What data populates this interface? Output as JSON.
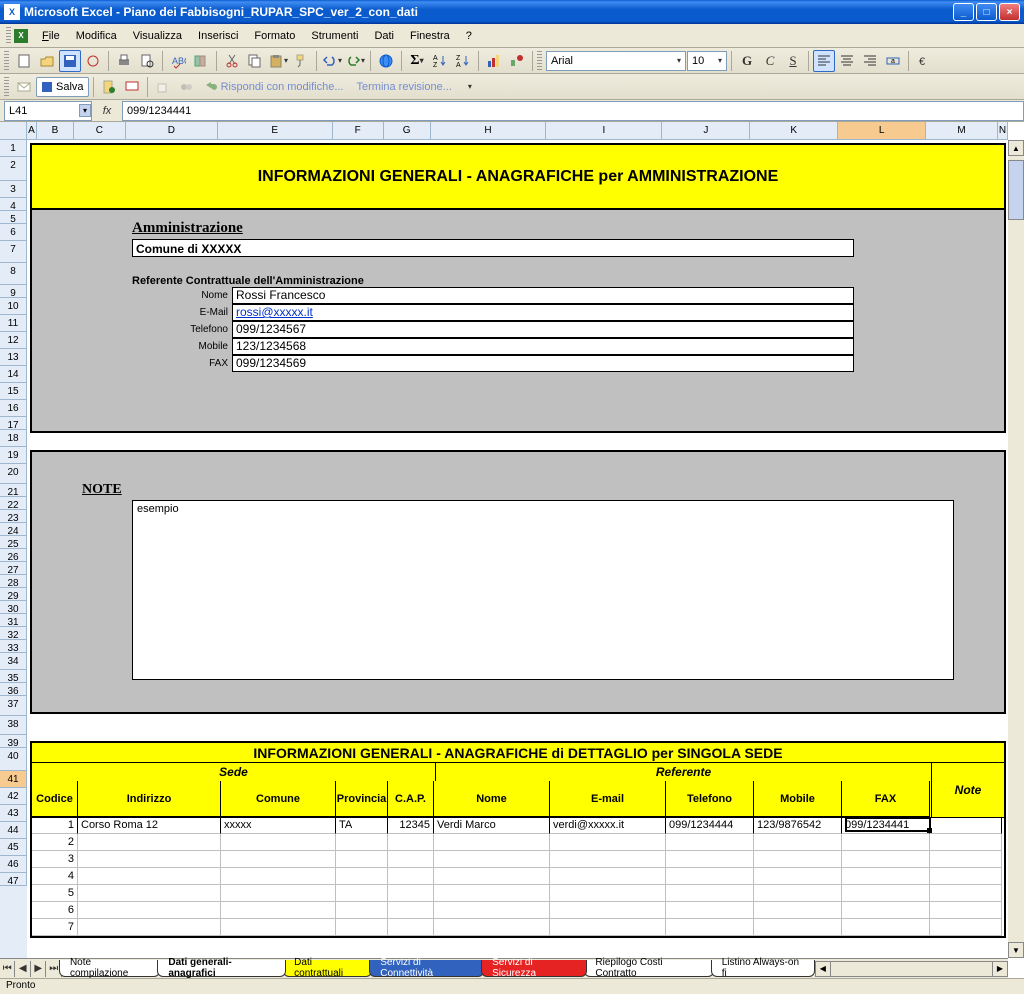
{
  "window": {
    "app": "Microsoft Excel",
    "document": "Piano dei Fabbisogni_RUPAR_SPC_ver_2_con_dati"
  },
  "menus": {
    "file": "File",
    "modifica": "Modifica",
    "visualizza": "Visualizza",
    "inserisci": "Inserisci",
    "formato": "Formato",
    "strumenti": "Strumenti",
    "dati": "Dati",
    "finestra": "Finestra",
    "help": "?"
  },
  "toolbar2": {
    "salva": "Salva",
    "rispondi": "Rispondi con modifiche...",
    "termina": "Termina revisione..."
  },
  "font": {
    "name": "Arial",
    "size": "10"
  },
  "namebox": "L41",
  "formula": "099/1234441",
  "columns": [
    "A",
    "B",
    "C",
    "D",
    "E",
    "F",
    "G",
    "H",
    "I",
    "J",
    "K",
    "L",
    "M",
    "N"
  ],
  "rows": [
    "1",
    "2",
    "3",
    "4",
    "5",
    "6",
    "7",
    "8",
    "9",
    "10",
    "11",
    "12",
    "13",
    "14",
    "15",
    "16",
    "17",
    "18",
    "19",
    "20",
    "21",
    "22",
    "23",
    "24",
    "25",
    "26",
    "27",
    "28",
    "29",
    "30",
    "31",
    "32",
    "33",
    "34",
    "35",
    "36",
    "37",
    "38",
    "39",
    "40",
    "41",
    "42",
    "43",
    "44",
    "45",
    "46",
    "47"
  ],
  "section1": {
    "title": "INFORMAZIONI GENERALI - ANAGRAFICHE per AMMINISTRAZIONE",
    "admin_label": "Amministrazione",
    "admin_value": "Comune di XXXXX",
    "ref_label": "Referente Contrattuale dell'Amministrazione",
    "fields": {
      "nome_l": "Nome",
      "nome_v": "Rossi Francesco",
      "email_l": "E-Mail",
      "email_v": "rossi@xxxxx.it",
      "tel_l": "Telefono",
      "tel_v": "099/1234567",
      "mob_l": "Mobile",
      "mob_v": "123/1234568",
      "fax_l": "FAX",
      "fax_v": "099/1234569"
    }
  },
  "section2": {
    "label": "NOTE",
    "value": "esempio"
  },
  "section3": {
    "title": "INFORMAZIONI GENERALI - ANAGRAFICHE di DETTAGLIO per SINGOLA SEDE",
    "groups": {
      "sede": "Sede",
      "referente": "Referente",
      "note": "Note"
    },
    "headers": {
      "codice": "Codice",
      "indirizzo": "Indirizzo",
      "comune": "Comune",
      "provincia": "Provincia",
      "cap": "C.A.P.",
      "nome": "Nome",
      "email": "E-mail",
      "telefono": "Telefono",
      "mobile": "Mobile",
      "fax": "FAX"
    },
    "row1": {
      "codice": "1",
      "indirizzo": "Corso Roma 12",
      "comune": "xxxxx",
      "provincia": "TA",
      "cap": "12345",
      "nome": "Verdi Marco",
      "email": "verdi@xxxxx.it",
      "telefono": "099/1234444",
      "mobile": "123/9876542",
      "fax": "099/1234441",
      "note": ""
    },
    "rows_other": [
      "2",
      "3",
      "4",
      "5",
      "6",
      "7"
    ]
  },
  "tabs": {
    "t1": "Note compilazione",
    "t2": "Dati generali-anagrafici",
    "t3": "Dati contrattuali",
    "t4": "Servizi di Connettività",
    "t5": "Servizi di Sicurezza",
    "t6": "Riepilogo Costi Contratto",
    "t7": "Listino Always-on fi"
  },
  "status": "Pronto"
}
